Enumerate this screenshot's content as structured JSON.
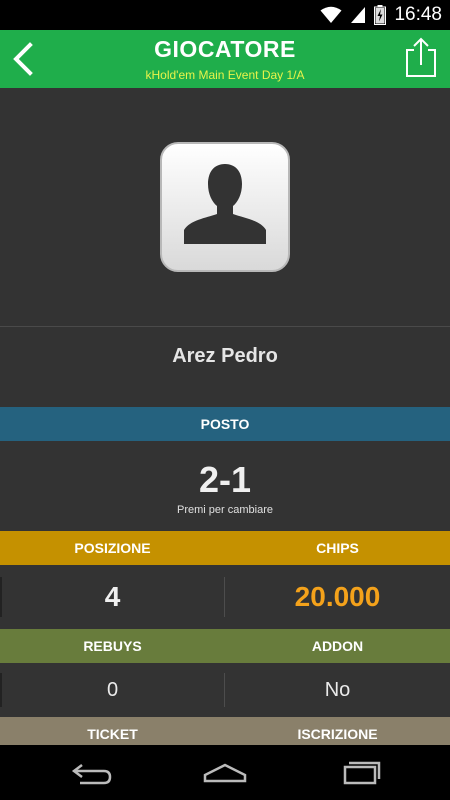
{
  "status": {
    "time": "16:48",
    "icons": [
      "wifi-icon",
      "signal-icon",
      "battery-icon"
    ]
  },
  "appbar": {
    "title": "GIOCATORE",
    "subtitle": "kHold'em Main Event Day 1/A",
    "color": "#1fae4b",
    "subtitle_color": "#e8f34a"
  },
  "player": {
    "name": "Arez Pedro"
  },
  "posto": {
    "header": "POSTO",
    "value": "2-1",
    "hint": "Premi per cambiare",
    "header_color": "#25627f"
  },
  "position_chips": {
    "headers": [
      "POSIZIONE",
      "CHIPS"
    ],
    "position": "4",
    "chips": "20.000",
    "header_color": "#c59100",
    "chips_color": "#f4a21b"
  },
  "rebuys_addon": {
    "headers": [
      "REBUYS",
      "ADDON"
    ],
    "rebuys": "0",
    "addon": "No",
    "header_color": "#687c3c"
  },
  "ticket_iscrizione": {
    "headers": [
      "TICKET",
      "ISCRIZIONE"
    ],
    "header_color": "#8a806a"
  }
}
